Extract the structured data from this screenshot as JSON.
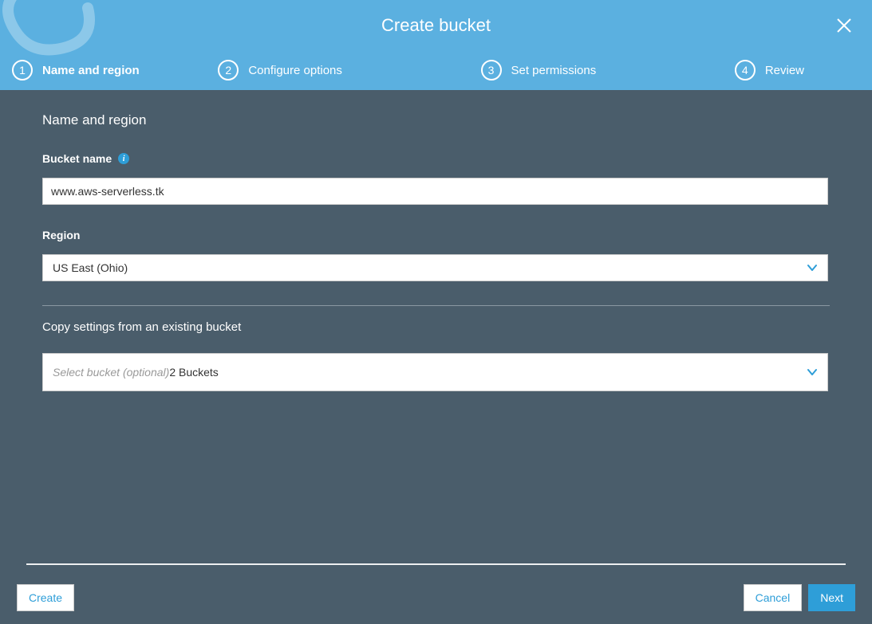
{
  "header": {
    "title": "Create bucket"
  },
  "steps": [
    {
      "number": "1",
      "label": "Name and region",
      "active": true
    },
    {
      "number": "2",
      "label": "Configure options",
      "active": false
    },
    {
      "number": "3",
      "label": "Set permissions",
      "active": false
    },
    {
      "number": "4",
      "label": "Review",
      "active": false
    }
  ],
  "form": {
    "section_title": "Name and region",
    "bucket_name": {
      "label": "Bucket name",
      "value": "www.aws-serverless.tk"
    },
    "region": {
      "label": "Region",
      "value": "US East (Ohio)"
    },
    "copy_settings": {
      "label": "Copy settings from an existing bucket",
      "placeholder": "Select bucket (optional)",
      "count_text": "2 Buckets"
    }
  },
  "footer": {
    "create_label": "Create",
    "cancel_label": "Cancel",
    "next_label": "Next"
  }
}
